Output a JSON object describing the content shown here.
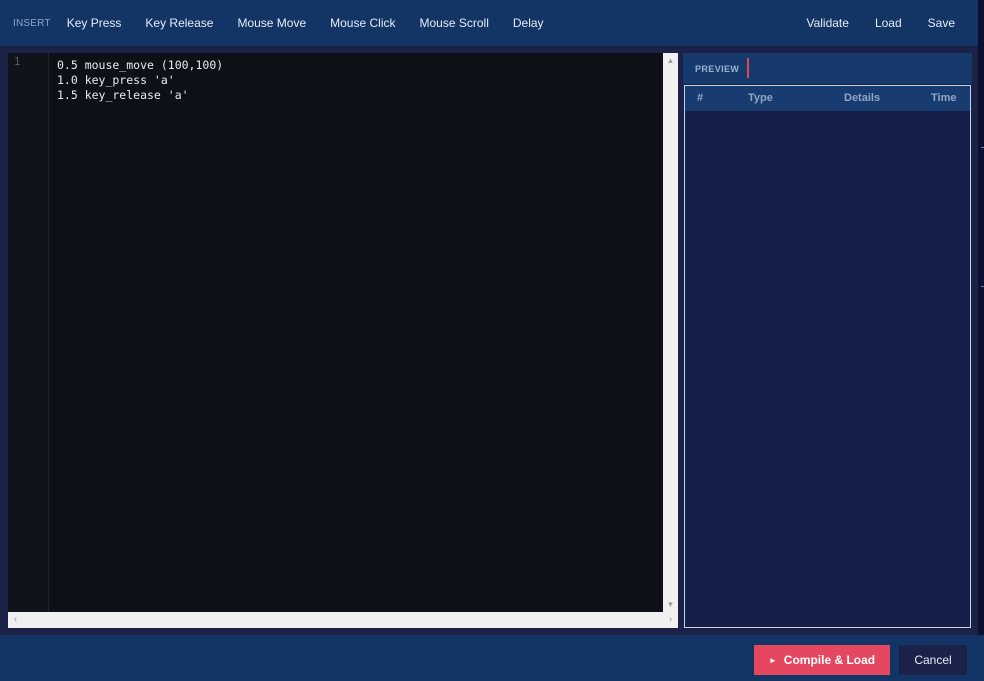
{
  "toolbar": {
    "insert_label": "INSERT",
    "items": [
      {
        "label": "Key Press"
      },
      {
        "label": "Key Release"
      },
      {
        "label": "Mouse Move"
      },
      {
        "label": "Mouse Click"
      },
      {
        "label": "Mouse Scroll"
      },
      {
        "label": "Delay"
      }
    ],
    "validate_label": "Validate",
    "load_label": "Load",
    "save_label": "Save"
  },
  "editor": {
    "line_number": "1",
    "code": "0.5 mouse_move (100,100)\n1.0 key_press 'a'\n1.5 key_release 'a'"
  },
  "preview": {
    "title": "PREVIEW",
    "columns": {
      "num": "#",
      "type": "Type",
      "details": "Details",
      "time": "Time"
    },
    "rows": []
  },
  "footer": {
    "compile_label": "Compile & Load",
    "cancel_label": "Cancel"
  },
  "colors": {
    "toolbar_bg": "#133566",
    "accent": "#e4475f",
    "editor_bg": "#0d1117"
  },
  "icons": {
    "compile": "play-icon",
    "scroll_up": "chevron-up-icon",
    "scroll_down": "chevron-down-icon",
    "scroll_left": "chevron-left-icon",
    "scroll_right": "chevron-right-icon"
  }
}
